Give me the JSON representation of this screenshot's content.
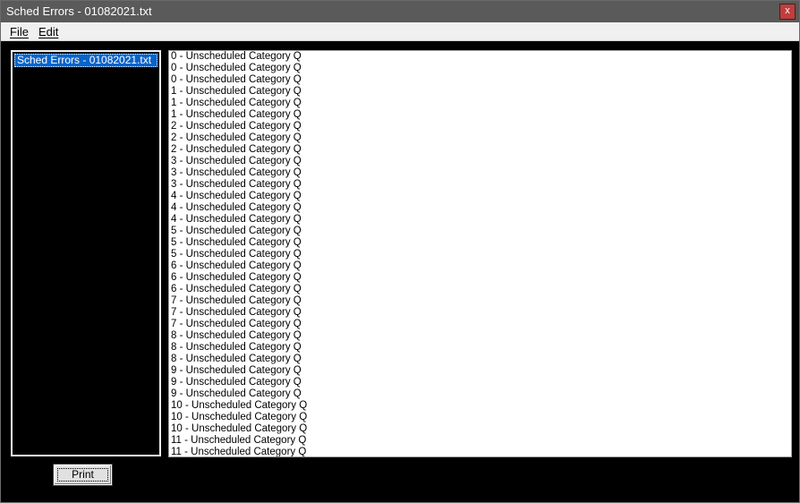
{
  "window": {
    "title": "Sched Errors - 01082021.txt",
    "close_label": "x"
  },
  "menu": {
    "items": [
      {
        "label": "File"
      },
      {
        "label": "Edit"
      }
    ]
  },
  "file_list": {
    "selected": "Sched Errors - 01082021.txt"
  },
  "log": {
    "lines": [
      "0 - Unscheduled Category Q",
      "0 - Unscheduled Category Q",
      "0 - Unscheduled Category Q",
      "1 - Unscheduled Category Q",
      "1 - Unscheduled Category Q",
      "1 - Unscheduled Category Q",
      "2 - Unscheduled Category Q",
      "2 - Unscheduled Category Q",
      "2 - Unscheduled Category Q",
      "3 - Unscheduled Category Q",
      "3 - Unscheduled Category Q",
      "3 - Unscheduled Category Q",
      "4 - Unscheduled Category Q",
      "4 - Unscheduled Category Q",
      "4 - Unscheduled Category Q",
      "5 - Unscheduled Category Q",
      "5 - Unscheduled Category Q",
      "5 - Unscheduled Category Q",
      "6 - Unscheduled Category Q",
      "6 - Unscheduled Category Q",
      "6 - Unscheduled Category Q",
      "7 - Unscheduled Category Q",
      "7 - Unscheduled Category Q",
      "7 - Unscheduled Category Q",
      "8 - Unscheduled Category Q",
      "8 - Unscheduled Category Q",
      "8 - Unscheduled Category Q",
      "9 - Unscheduled Category Q",
      "9 - Unscheduled Category Q",
      "9 - Unscheduled Category Q",
      "10 - Unscheduled Category Q",
      "10 - Unscheduled Category Q",
      "10 - Unscheduled Category Q",
      "11 - Unscheduled Category Q",
      "11 - Unscheduled Category Q"
    ]
  },
  "buttons": {
    "print": "Print"
  },
  "colors": {
    "titlebar": "#5a5a5a",
    "selection": "#0a64c8",
    "close": "#c43c3c",
    "background": "#000000"
  }
}
